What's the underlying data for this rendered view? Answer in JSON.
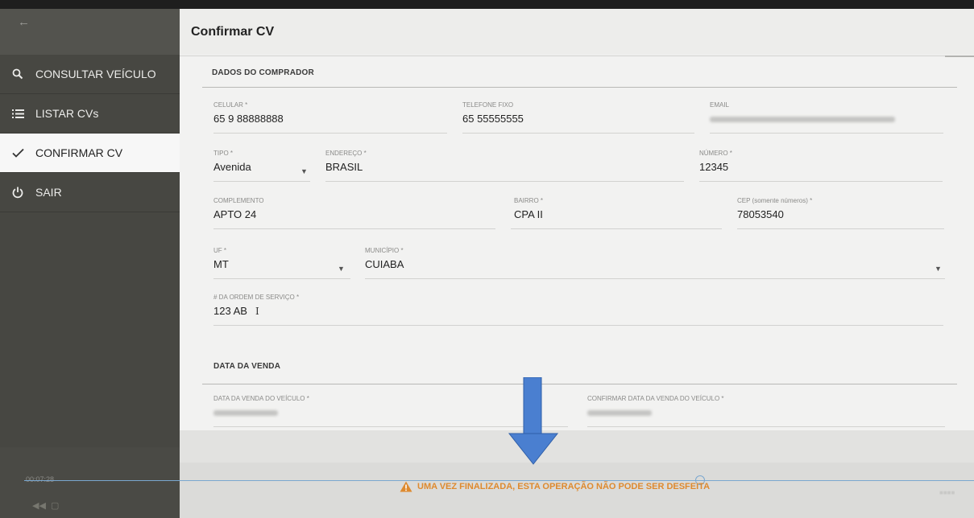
{
  "app": {
    "back_icon": "arrow-left-icon"
  },
  "sidebar": {
    "items": [
      {
        "label": "CONSULTAR VEÍCULO",
        "icon": "search-icon"
      },
      {
        "label": "LISTAR CVs",
        "icon": "list-icon"
      },
      {
        "label": "CONFIRMAR CV",
        "icon": "check-icon",
        "active": true
      },
      {
        "label": "SAIR",
        "icon": "power-icon"
      }
    ]
  },
  "header": {
    "title": "Confirmar CV"
  },
  "comprador": {
    "title": "DADOS DO COMPRADOR",
    "celular": {
      "label": "CELULAR *",
      "value": "65 9 88888888"
    },
    "telefone": {
      "label": "TELEFONE FIXO",
      "value": "65 55555555"
    },
    "email": {
      "label": "EMAIL"
    },
    "tipo": {
      "label": "TIPO *",
      "value": "Avenida"
    },
    "endereco": {
      "label": "ENDEREÇO *",
      "value": "BRASIL"
    },
    "numero": {
      "label": "NÚMERO *",
      "value": "12345"
    },
    "complemento": {
      "label": "COMPLEMENTO",
      "value": "APTO 24"
    },
    "bairro": {
      "label": "BAIRRO *",
      "value": "CPA II"
    },
    "cep": {
      "label": "CEP (somente números) *",
      "value": "78053540"
    },
    "uf": {
      "label": "UF *",
      "value": "MT"
    },
    "municipio": {
      "label": "MUNICÍPIO *",
      "value": "CUIABA"
    },
    "ordem": {
      "label": "# DA ORDEM DE SERVIÇO *",
      "value": "123 AB"
    }
  },
  "venda": {
    "title": "DATA DA VENDA",
    "data": {
      "label": "DATA DA VENDA DO VEÍCULO *"
    },
    "confirmar": {
      "label": "CONFIRMAR DATA DA VENDA DO VEÍCULO *"
    }
  },
  "footer": {
    "warning": "UMA VEZ FINALIZADA, ESTA OPERAÇÃO NÃO PODE SER DESFEITA",
    "time_elapsed": "00:07:28"
  },
  "colors": {
    "warning": "#de8a2f",
    "arrow": "#4a7fd0",
    "progress": "#7aa7cf"
  }
}
